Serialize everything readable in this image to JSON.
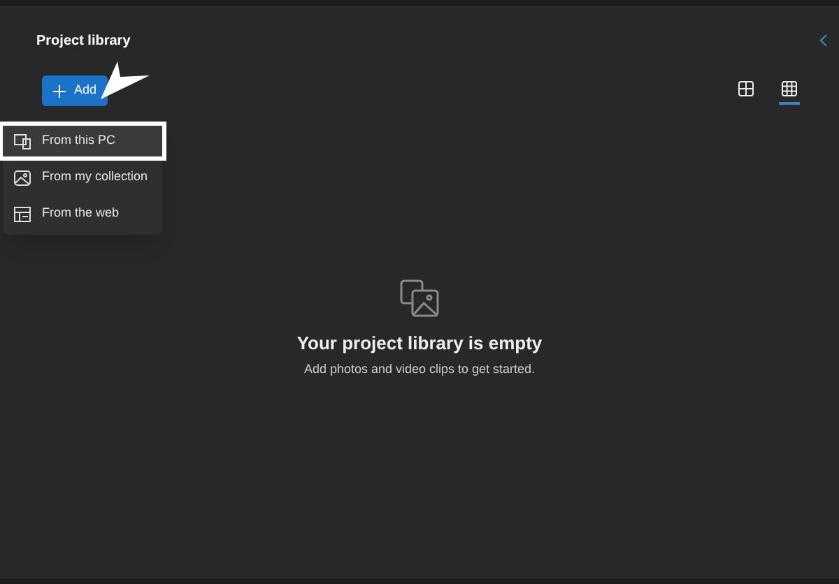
{
  "header": {
    "title": "Project library"
  },
  "add_button": {
    "label": "Add",
    "menu_open": true
  },
  "menu": [
    {
      "label": "From this PC",
      "kind": "pc",
      "selected": true
    },
    {
      "label": "From my collection",
      "kind": "collection",
      "selected": false
    },
    {
      "label": "From the web",
      "kind": "web",
      "selected": false
    }
  ],
  "view_toggles": [
    {
      "kind": "large",
      "selected": false
    },
    {
      "kind": "small",
      "selected": true
    }
  ],
  "empty_state": {
    "title": "Your project library is empty",
    "subtitle": "Add photos and video clips to get started."
  }
}
